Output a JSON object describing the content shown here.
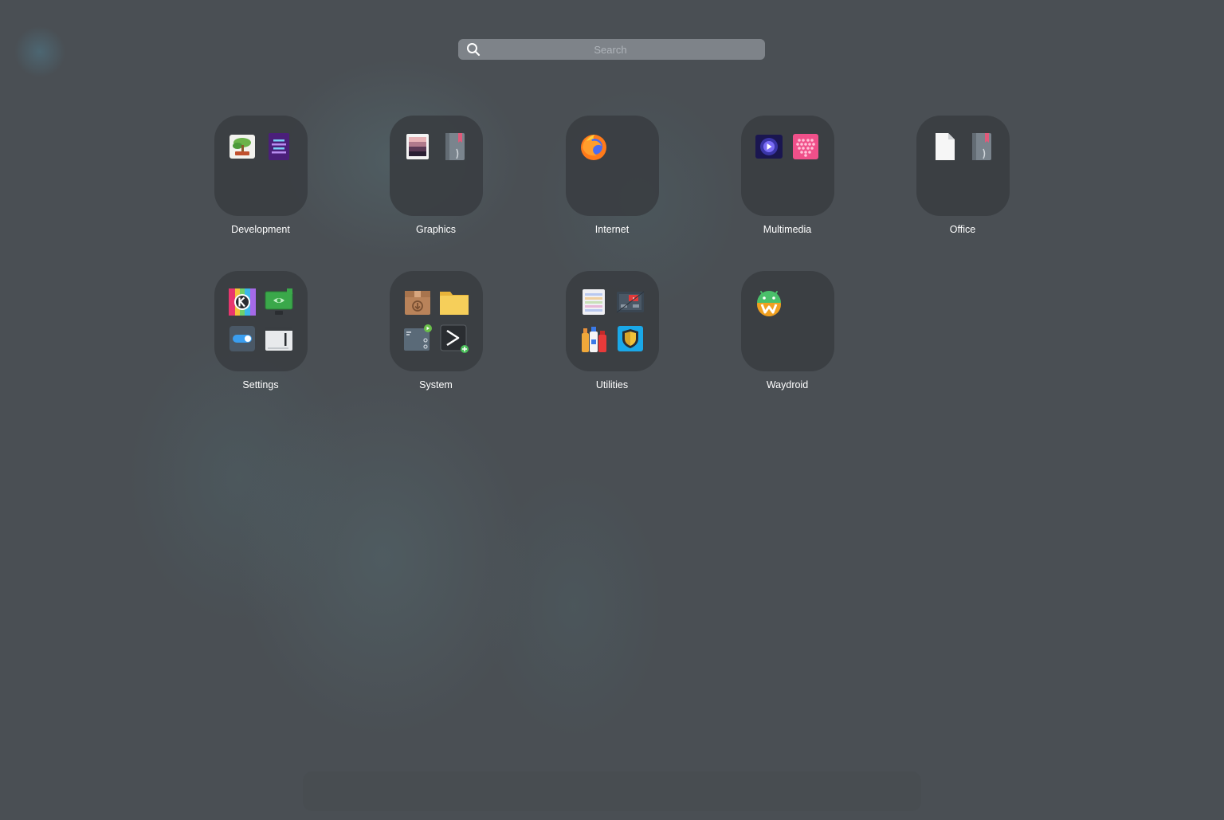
{
  "search": {
    "placeholder": "Search",
    "value": ""
  },
  "folders": [
    {
      "label": "Development",
      "icons": [
        "bonsai-app-icon",
        "code-editor-icon"
      ]
    },
    {
      "label": "Graphics",
      "icons": [
        "color-palette-icon",
        "notebook-icon"
      ]
    },
    {
      "label": "Internet",
      "icons": [
        "firefox-icon"
      ]
    },
    {
      "label": "Multimedia",
      "icons": [
        "video-player-icon",
        "audio-visualizer-icon"
      ]
    },
    {
      "label": "Office",
      "icons": [
        "document-icon",
        "notebook-icon"
      ]
    },
    {
      "label": "Settings",
      "icons": [
        "kde-color-settings-icon",
        "nvidia-settings-icon",
        "toggle-switch-icon",
        "window-manager-icon"
      ]
    },
    {
      "label": "System",
      "icons": [
        "package-installer-icon",
        "file-manager-folder-icon",
        "system-monitor-icon",
        "terminal-icon"
      ]
    },
    {
      "label": "Utilities",
      "icons": [
        "notes-list-icon",
        "hardware-info-icon",
        "cleaning-bottles-icon",
        "security-shield-icon"
      ]
    },
    {
      "label": "Waydroid",
      "icons": [
        "waydroid-icon"
      ]
    }
  ],
  "colors": {
    "background": "#4a4f54",
    "tile": "#3a3e42",
    "label": "#ffffff"
  }
}
